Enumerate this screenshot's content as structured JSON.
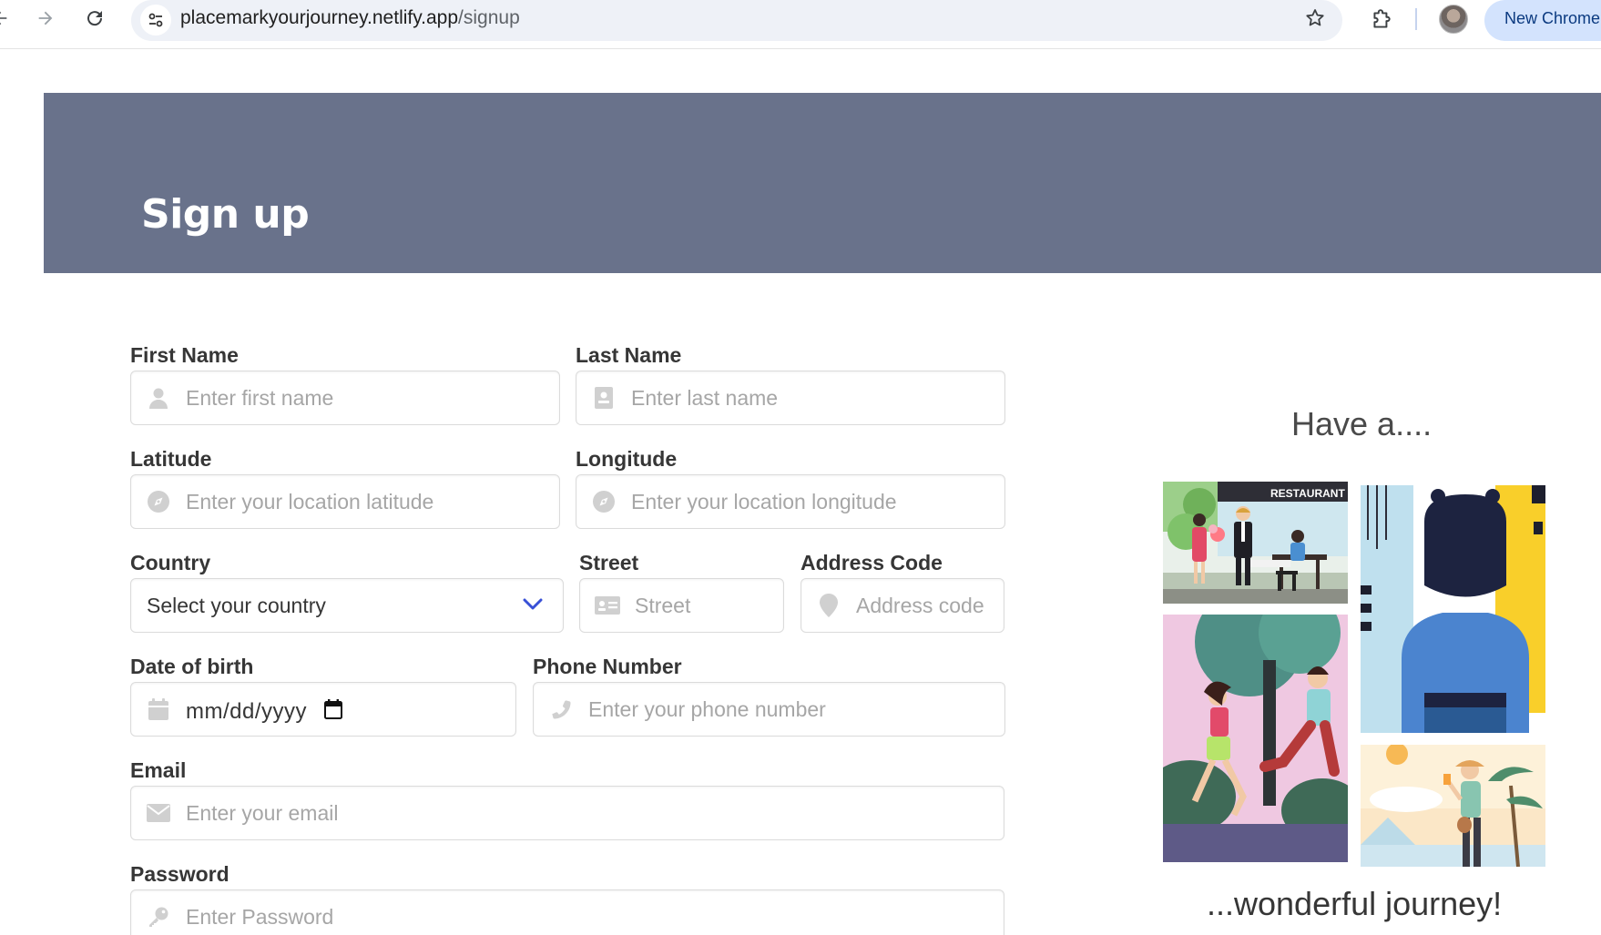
{
  "browser": {
    "url_host": "placemarkyourjourney.netlify.app",
    "url_path": "/signup",
    "new_chrome_label": "New Chrome"
  },
  "hero": {
    "title": "Sign up"
  },
  "form": {
    "first_name": {
      "label": "First Name",
      "placeholder": "Enter first name",
      "icon": "user-icon"
    },
    "last_name": {
      "label": "Last Name",
      "placeholder": "Enter last name",
      "icon": "id-badge-icon"
    },
    "latitude": {
      "label": "Latitude",
      "placeholder": "Enter your location latitude",
      "icon": "compass-icon"
    },
    "longitude": {
      "label": "Longitude",
      "placeholder": "Enter your location longitude",
      "icon": "compass-icon"
    },
    "country": {
      "label": "Country",
      "selected": "Select your country"
    },
    "street": {
      "label": "Street",
      "placeholder": "Street",
      "icon": "id-card-icon"
    },
    "address_code": {
      "label": "Address Code",
      "placeholder": "Address code",
      "icon": "map-pin-icon"
    },
    "date_of_birth": {
      "label": "Date of birth",
      "value": "mm/dd/yyyy",
      "icon": "calendar-icon"
    },
    "phone": {
      "label": "Phone Number",
      "placeholder": "Enter your phone number",
      "icon": "phone-icon"
    },
    "email": {
      "label": "Email",
      "placeholder": "Enter your email",
      "icon": "envelope-icon"
    },
    "password": {
      "label": "Password",
      "placeholder": "Enter Password",
      "icon": "key-icon"
    }
  },
  "illustration": {
    "top_caption": "Have a....",
    "bottom_caption": "...wonderful journey!",
    "restaurant_sign": "RESTAURANT"
  },
  "colors": {
    "hero_bg": "#69728b",
    "chevron": "#3850d6",
    "placeholder": "#a6a6a6",
    "border": "#dbdbdb"
  }
}
